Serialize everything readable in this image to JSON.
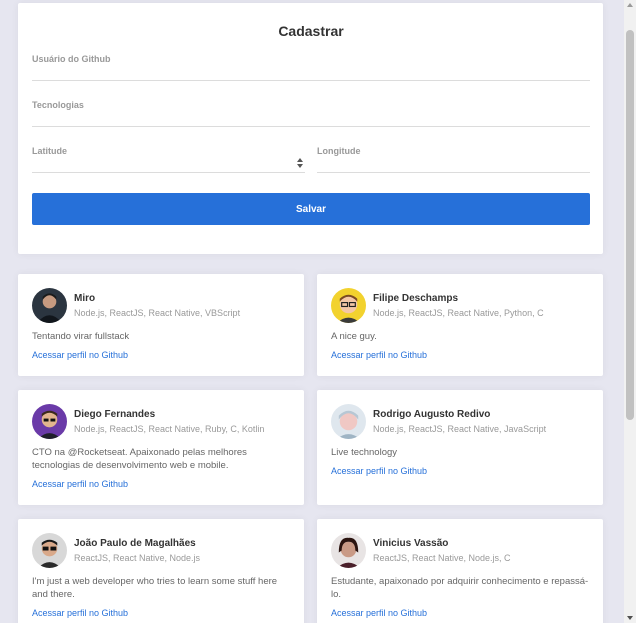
{
  "form": {
    "title": "Cadastrar",
    "github_label": "Usuário do Github",
    "github_value": "",
    "techs_label": "Tecnologias",
    "techs_value": "",
    "latitude_label": "Latitude",
    "latitude_value": "",
    "longitude_label": "Longitude",
    "longitude_value": "",
    "save_label": "Salvar"
  },
  "colors": {
    "background": "#e6e6f0",
    "accent": "#2670d9",
    "card": "#ffffff"
  },
  "link_label": "Acessar perfil no Github",
  "devs": [
    {
      "name": "Miro",
      "techs": "Node.js, ReactJS, React Native, VBScript",
      "bio": "Tentando virar fullstack",
      "link": "Acessar perfil no Github"
    },
    {
      "name": "Filipe Deschamps",
      "techs": "Node.js, ReactJS, React Native, Python, C",
      "bio": "A nice guy.",
      "link": "Acessar perfil no Github"
    },
    {
      "name": "Diego Fernandes",
      "techs": "Node.js, ReactJS, React Native, Ruby, C, Kotlin",
      "bio": "CTO na @Rocketseat. Apaixonado pelas melhores tecnologias de desenvolvimento web e mobile.",
      "link": "Acessar perfil no Github"
    },
    {
      "name": "Rodrigo Augusto Redivo",
      "techs": "Node.js, ReactJS, React Native, JavaScript",
      "bio": "Live technology",
      "link": "Acessar perfil no Github"
    },
    {
      "name": "João Paulo de Magalhães",
      "techs": "ReactJS, React Native, Node.js",
      "bio": "I'm just a web developer who tries to learn some stuff here and there.",
      "link": "Acessar perfil no Github"
    },
    {
      "name": "Vinicius Vassão",
      "techs": "ReactJS, React Native, Node.js, C",
      "bio": "Estudante, apaixonado por adquirir conhecimento e repassá-lo.",
      "link": "Acessar perfil no Github"
    }
  ]
}
